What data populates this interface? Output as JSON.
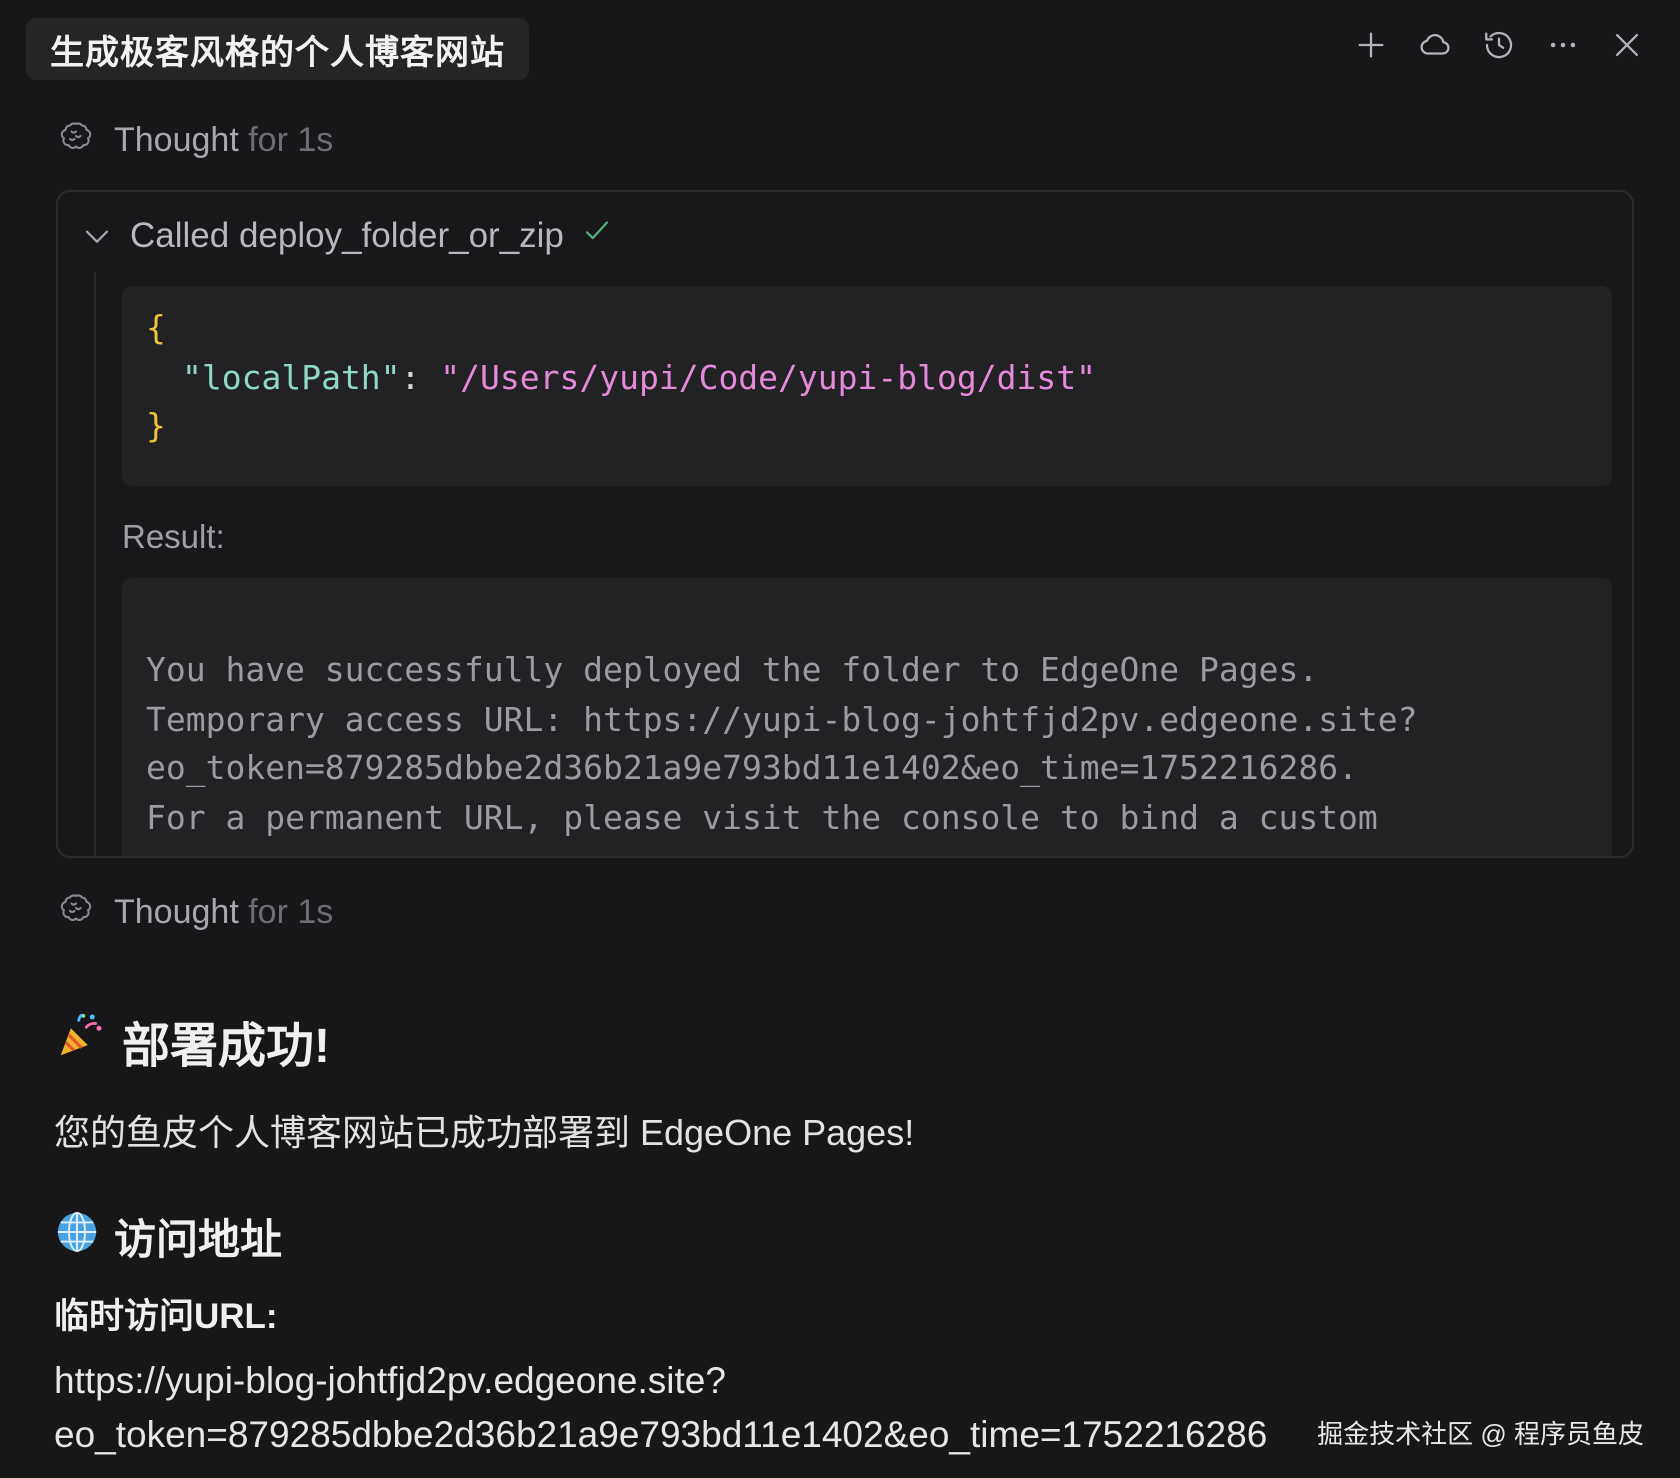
{
  "header": {
    "tab_title": "生成极客风格的个人博客网站",
    "icons": [
      "plus-icon",
      "cloud-icon",
      "history-icon",
      "more-icon",
      "close-icon"
    ]
  },
  "thoughts": [
    {
      "label": "Thought",
      "suffix": " for 1s"
    },
    {
      "label": "Thought",
      "suffix": " for 1s"
    }
  ],
  "tool_call": {
    "label": "Called deploy_folder_or_zip",
    "status": "success",
    "args": {
      "open_brace": "{",
      "key": "\"localPath\"",
      "colon": ": ",
      "value": "\"/Users/yupi/Code/yupi-blog/dist\"",
      "close_brace": "}"
    },
    "result_label": "Result:",
    "result_lines": [
      "You have successfully deployed the folder to EdgeOne Pages.",
      "Temporary access URL: https://yupi-blog-johtfjd2pv.edgeone.site?",
      "eo_token=879285dbbe2d36b21a9e793bd11e1402&eo_time=1752216286.",
      "For a permanent URL, please visit the console to bind a custom"
    ]
  },
  "answer": {
    "heading": "部署成功!",
    "heading_emoji": "party-popper-icon",
    "intro": "您的鱼皮个人博客网站已成功部署到 EdgeOne Pages!",
    "section_heading": "访问地址",
    "section_emoji": "globe-icon",
    "url_label": "临时访问URL:",
    "url_line1": "https://yupi-blog-johtfjd2pv.edgeone.site?",
    "url_line2": "eo_token=879285dbbe2d36b21a9e793bd11e1402&eo_time=1752216286"
  },
  "watermark": "掘金技术社区 @ 程序员鱼皮",
  "colors": {
    "background": "#171719",
    "json_brace": "#f0c23b",
    "json_key": "#8fd8c8",
    "json_string": "#e48ad8",
    "check": "#4fb37a"
  }
}
